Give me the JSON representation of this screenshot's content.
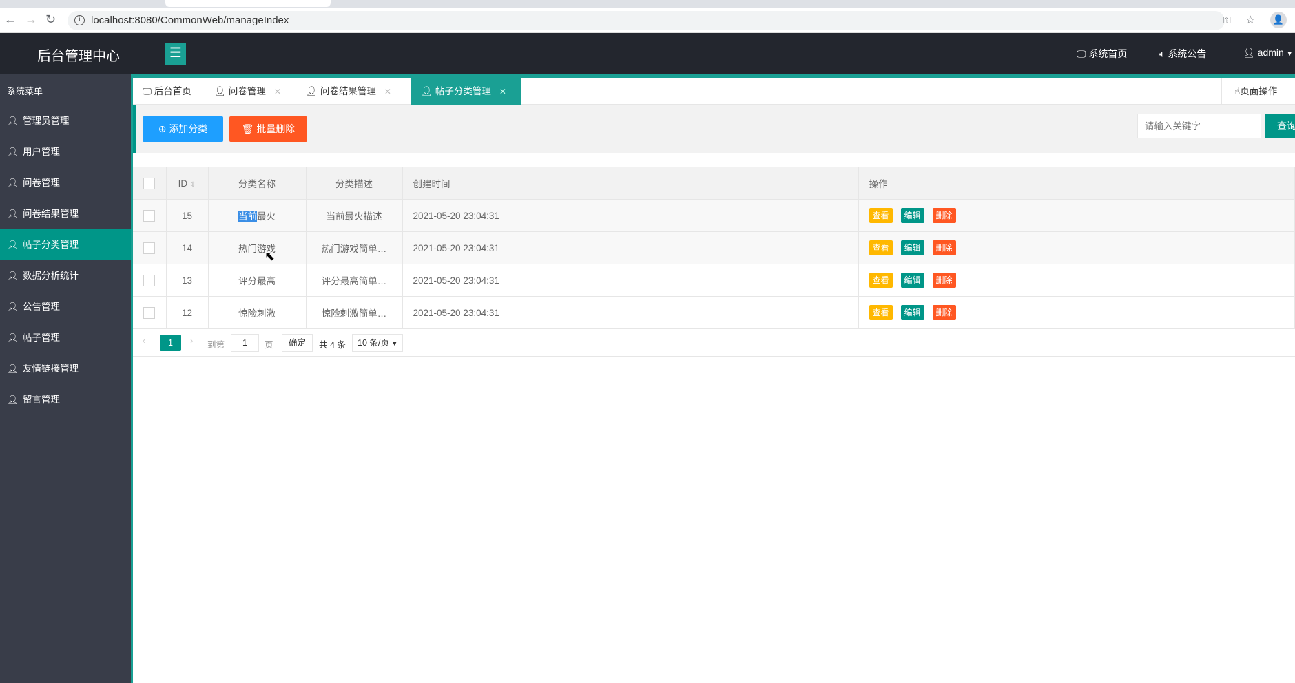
{
  "browser": {
    "url": "localhost:8080/CommonWeb/manageIndex"
  },
  "header": {
    "title": "后台管理中心",
    "nav": [
      {
        "label": "系统首页",
        "icon": "monitor-icon"
      },
      {
        "label": "系统公告",
        "icon": "speaker-icon"
      },
      {
        "label": "admin",
        "icon": "user-icon"
      }
    ]
  },
  "sidebar": {
    "title": "系统菜单",
    "items": [
      {
        "label": "管理员管理"
      },
      {
        "label": "用户管理"
      },
      {
        "label": "问卷管理"
      },
      {
        "label": "问卷结果管理"
      },
      {
        "label": "帖子分类管理",
        "active": true
      },
      {
        "label": "数据分析统计"
      },
      {
        "label": "公告管理"
      },
      {
        "label": "帖子管理"
      },
      {
        "label": "友情链接管理"
      },
      {
        "label": "留言管理"
      }
    ]
  },
  "tabs": [
    {
      "label": "后台首页"
    },
    {
      "label": "问卷管理"
    },
    {
      "label": "问卷结果管理"
    },
    {
      "label": "帖子分类管理",
      "active": true
    }
  ],
  "page_ops_label": "页面操作",
  "toolbar": {
    "add_label": "添加分类",
    "batch_delete_label": "批量删除",
    "search_placeholder": "请输入关键字",
    "query_label": "查询"
  },
  "table": {
    "columns": [
      "ID",
      "分类名称",
      "分类描述",
      "创建时间",
      "操作"
    ],
    "rows": [
      {
        "id": "15",
        "name": "当前最火",
        "desc": "当前最火描述",
        "created": "2021-05-20 23:04:31"
      },
      {
        "id": "14",
        "name": "热门游戏",
        "desc": "热门游戏简单…",
        "created": "2021-05-20 23:04:31"
      },
      {
        "id": "13",
        "name": "评分最高",
        "desc": "评分最高简单…",
        "created": "2021-05-20 23:04:31"
      },
      {
        "id": "12",
        "name": "惊险刺激",
        "desc": "惊险刺激简单…",
        "created": "2021-05-20 23:04:31"
      }
    ],
    "actions": {
      "view": "查看",
      "edit": "编辑",
      "delete": "删除"
    }
  },
  "pagination": {
    "current": "1",
    "goto_label": "到第",
    "goto_value": "1",
    "page_label": "页",
    "confirm_label": "确定",
    "total": "共 4 条",
    "page_size": "10 条/页"
  },
  "colors": {
    "accent": "#009688",
    "sidebar": "#393d49",
    "header": "#23262e",
    "view": "#ffb800",
    "delete": "#ff5722",
    "add": "#1e9fff"
  }
}
